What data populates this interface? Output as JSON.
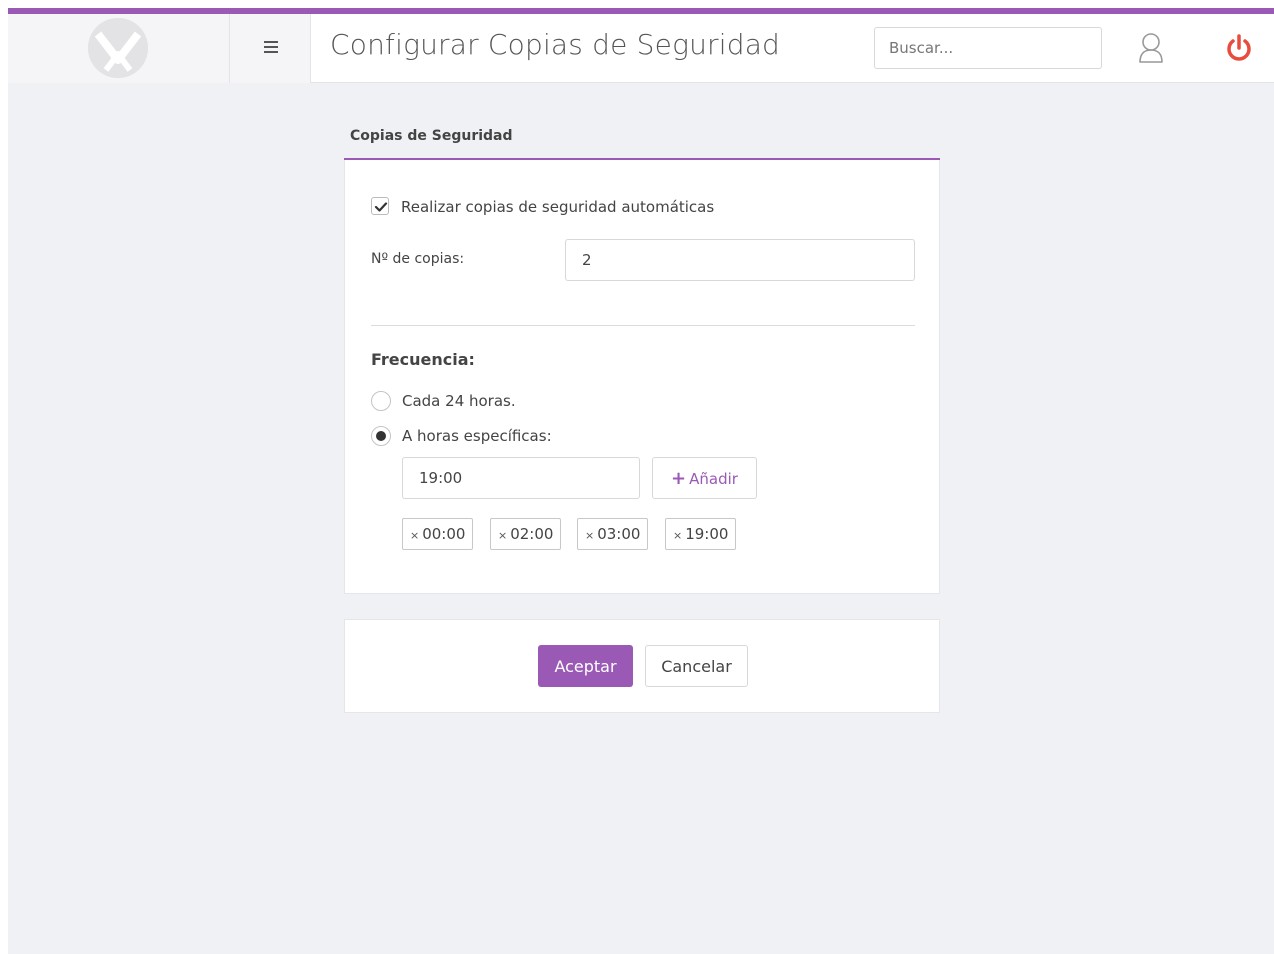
{
  "header": {
    "title": "Configurar Copias de Seguridad",
    "search_placeholder": "Buscar...",
    "logo_icon": "brand-logo-icon",
    "menu_icon": "hamburger-icon",
    "user_icon": "user-icon",
    "power_icon": "power-icon"
  },
  "panel": {
    "heading": "Copias de Seguridad",
    "auto_backup": {
      "label": "Realizar copias de seguridad automáticas",
      "checked": true
    },
    "copies": {
      "label": "Nº de copias:",
      "value": "2"
    },
    "frequency": {
      "heading": "Frecuencia:",
      "options": [
        {
          "label": "Cada 24 horas.",
          "selected": false
        },
        {
          "label": "A horas específicas:",
          "selected": true
        }
      ],
      "time_input_value": "19:00",
      "add_label": "Añadir",
      "times": [
        "00:00",
        "02:00",
        "03:00",
        "19:00"
      ]
    }
  },
  "footer": {
    "accept_label": "Aceptar",
    "cancel_label": "Cancelar"
  },
  "colors": {
    "accent": "#9b59b6",
    "power": "#e74c3c",
    "background": "#f0f1f5"
  }
}
